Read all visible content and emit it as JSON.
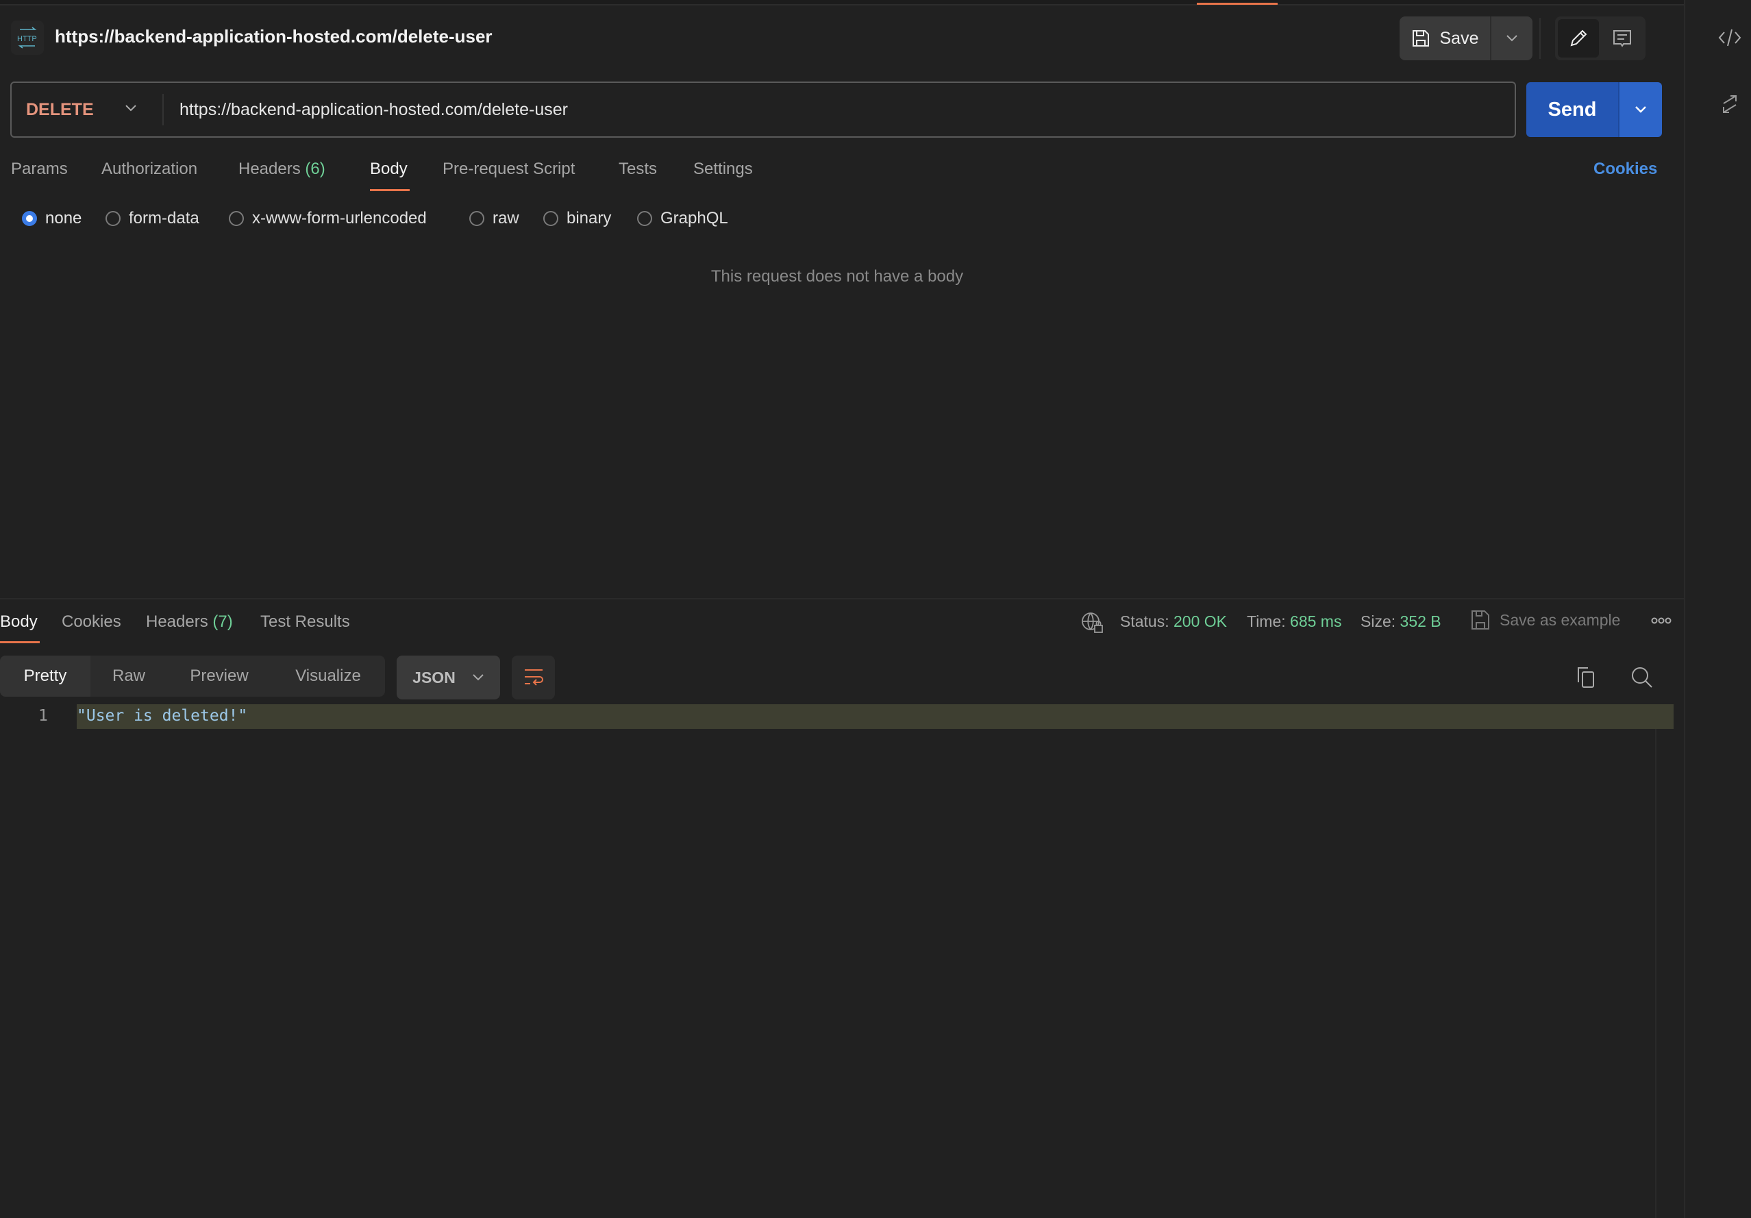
{
  "header": {
    "title": "https://backend-application-hosted.com/delete-user",
    "icon": "http-icon",
    "save_label": "Save"
  },
  "request": {
    "method": "DELETE",
    "url": "https://backend-application-hosted.com/delete-user",
    "send_label": "Send",
    "tabs": [
      {
        "label": "Params"
      },
      {
        "label": "Authorization"
      },
      {
        "label": "Headers",
        "count": "(6)"
      },
      {
        "label": "Body",
        "active": true
      },
      {
        "label": "Pre-request Script"
      },
      {
        "label": "Tests"
      },
      {
        "label": "Settings"
      }
    ],
    "cookies_label": "Cookies",
    "body_types": [
      {
        "label": "none",
        "selected": true
      },
      {
        "label": "form-data"
      },
      {
        "label": "x-www-form-urlencoded"
      },
      {
        "label": "raw"
      },
      {
        "label": "binary"
      },
      {
        "label": "GraphQL"
      }
    ],
    "empty_message": "This request does not have a body"
  },
  "response": {
    "tabs": [
      {
        "label": "Body",
        "active": true
      },
      {
        "label": "Cookies"
      },
      {
        "label": "Headers",
        "count": "(7)"
      },
      {
        "label": "Test Results"
      }
    ],
    "status_label": "Status:",
    "status": "200 OK",
    "time_label": "Time:",
    "time": "685 ms",
    "size_label": "Size:",
    "size": "352 B",
    "save_example": "Save as example",
    "views": [
      "Pretty",
      "Raw",
      "Preview",
      "Visualize"
    ],
    "format": "JSON",
    "lines": [
      {
        "num": "1",
        "text": "\"User is deleted!\""
      }
    ]
  },
  "colors": {
    "accent": "#e8744a",
    "send": "#2456b4",
    "link": "#4a8fe3",
    "success": "#6fcf97",
    "method_delete": "#e5947d"
  }
}
